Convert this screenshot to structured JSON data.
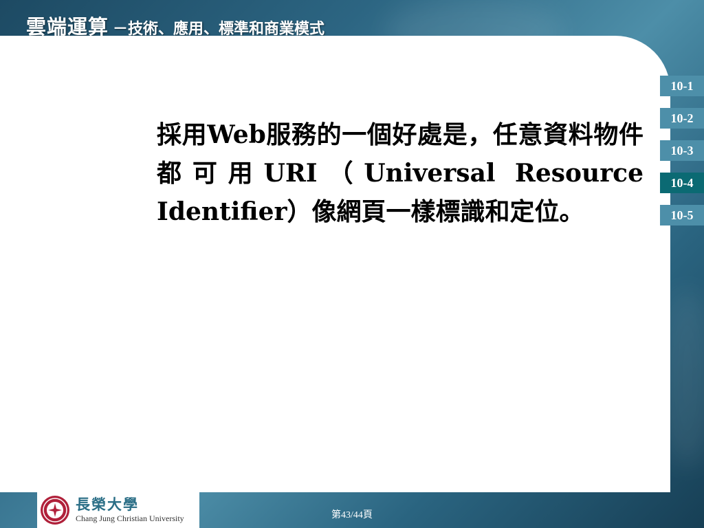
{
  "header": {
    "title_main": "雲端運算",
    "title_sub": "－技術、應用、標準和商業模式"
  },
  "content": {
    "paragraph": "採用Web服務的一個好處是，任意資料物件都可用URI（Universal Resource Identifier）像網頁一樣標識和定位。"
  },
  "nav": {
    "items": [
      {
        "label": "10-1"
      },
      {
        "label": "10-2"
      },
      {
        "label": "10-3"
      },
      {
        "label": "10-4",
        "active": true
      },
      {
        "label": "10-5"
      }
    ]
  },
  "footer": {
    "logo_zh": "長榮大學",
    "logo_en": "Chang Jung Christian University",
    "page_number": "第43/44頁"
  },
  "colors": {
    "nav_default": "#4d8fa9",
    "nav_active": "#0b6a73",
    "logo_text": "#2a6e86",
    "seal": "#b0203a"
  }
}
